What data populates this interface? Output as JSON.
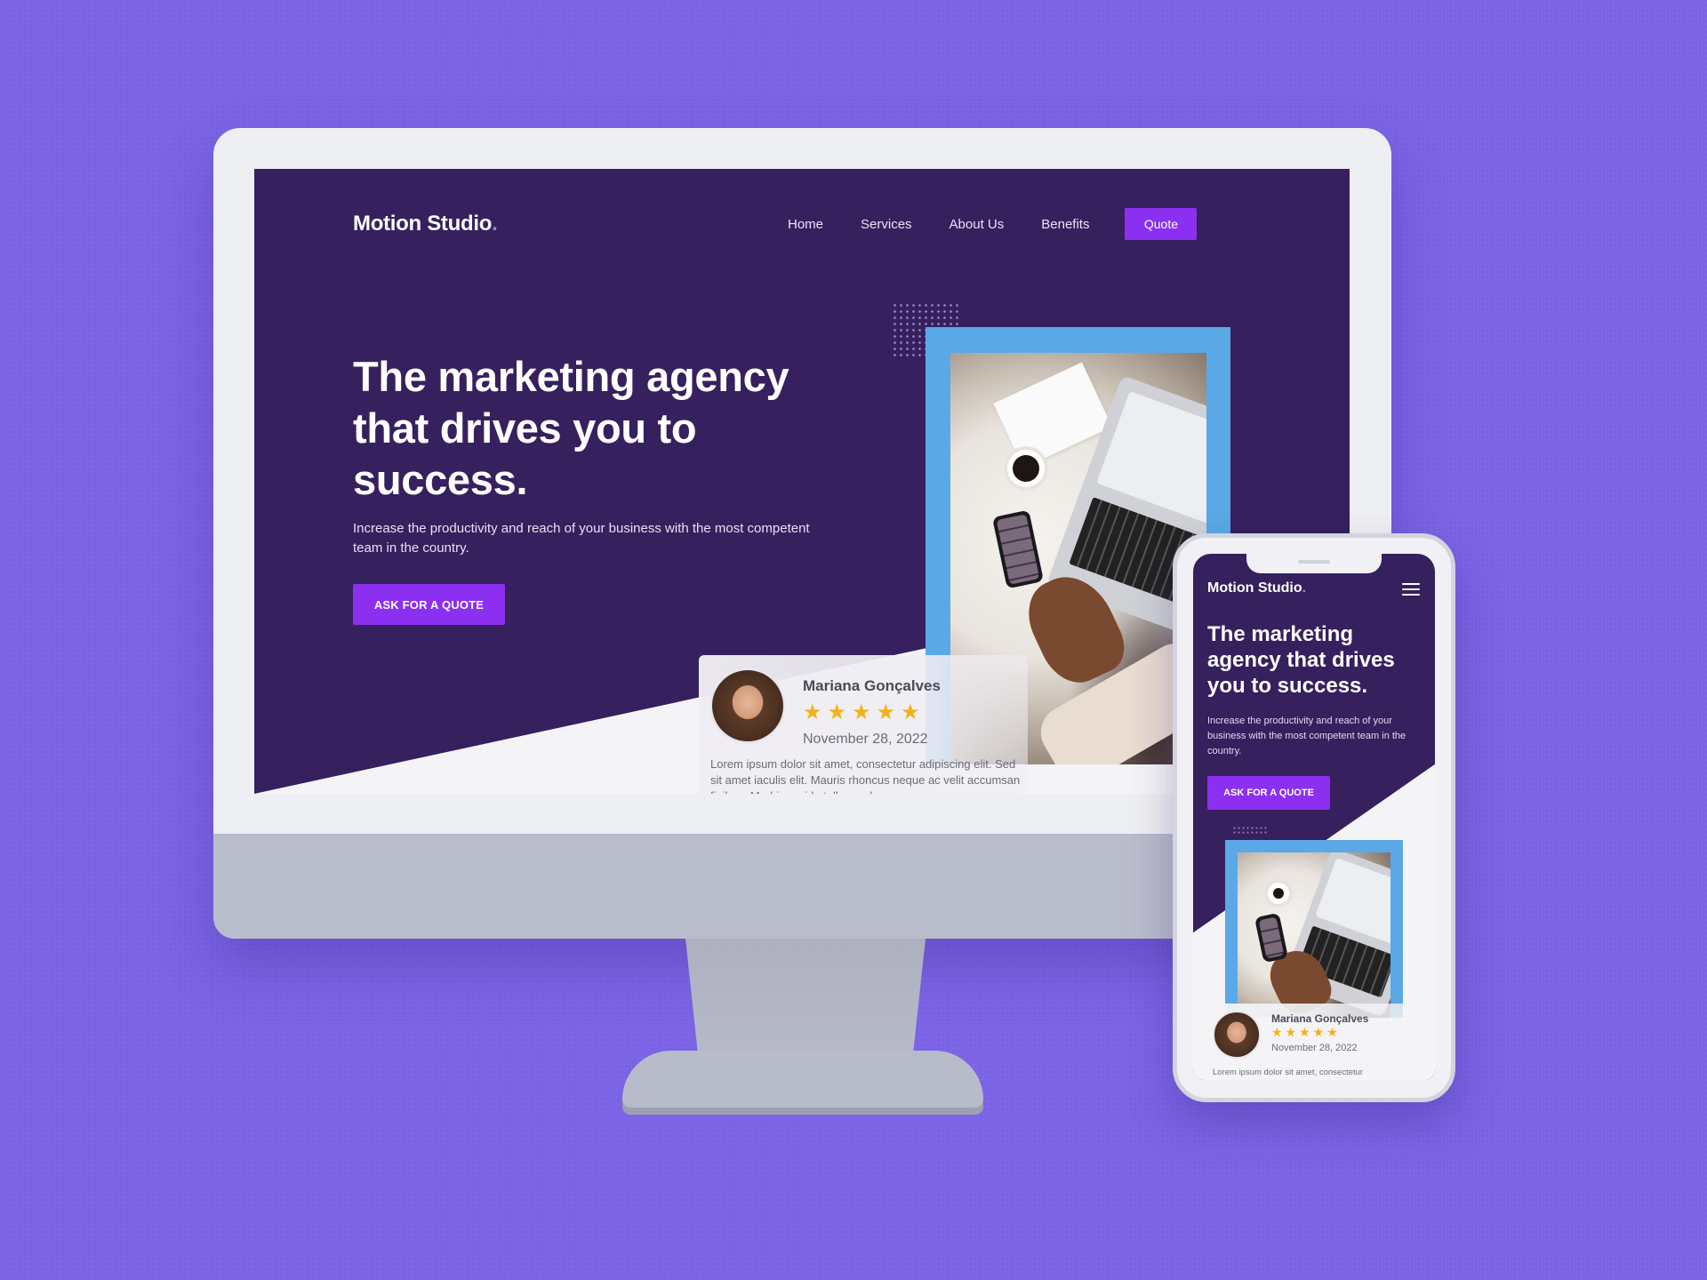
{
  "desktop": {
    "logo": "Motion Studio",
    "logo_dot": ".",
    "nav": [
      "Home",
      "Services",
      "About Us",
      "Benefits"
    ],
    "quote_button": "Quote",
    "headline": "The marketing agency that drives you to success.",
    "subtext": "Increase the productivity and reach of your business with the most competent team in the country.",
    "cta": "ASK FOR A  QUOTE",
    "review": {
      "name": "Mariana Gonçalves",
      "stars": "★★★★★",
      "rating": 5,
      "date": "November 28, 2022",
      "text": "Lorem ipsum dolor sit amet, consectetur adipiscing elit. Sed sit amet iaculis elit. Mauris rhoncus neque ac velit accumsan finibus. Morbi gravida tellus sed"
    }
  },
  "mobile": {
    "logo": "Motion Studio",
    "logo_dot": ".",
    "menu_icon": "hamburger-menu-icon",
    "headline": "The marketing agency that drives you to success.",
    "subtext": "Increase the productivity and reach of your business with the most competent team in the country.",
    "cta": "ASK FOR A QUOTE",
    "review": {
      "name": "Mariana Gonçalves",
      "stars": "★★★★★",
      "rating": 5,
      "date": "November 28, 2022",
      "text": "Lorem ipsum dolor sit amet, consectetur"
    }
  },
  "colors": {
    "background": "#7b63e6",
    "hero": "#36205e",
    "accent": "#8b2ff0",
    "frame": "#5aa8e6",
    "star": "#f2b118"
  }
}
